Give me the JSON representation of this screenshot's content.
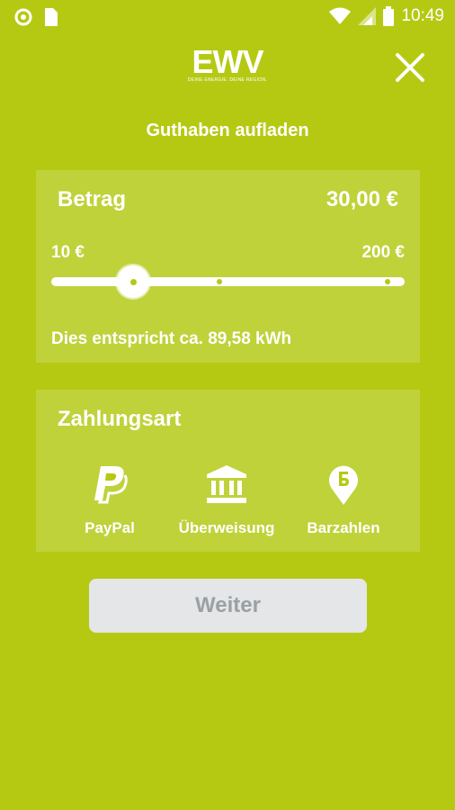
{
  "status_bar": {
    "time": "10:49"
  },
  "header": {
    "logo_text": "EWV",
    "logo_tagline": "DEINE ENERGIE. DEINE REGION.",
    "title": "Guthaben aufladen"
  },
  "amount_card": {
    "label": "Betrag",
    "value": "30,00 €",
    "slider": {
      "min_label": "10 €",
      "max_label": "200 €",
      "min": 10,
      "max": 200,
      "value": 30
    },
    "equivalent": "Dies entspricht ca. 89,58 kWh"
  },
  "payment_card": {
    "title": "Zahlungsart",
    "options": [
      {
        "label": "PayPal",
        "icon": "paypal-icon"
      },
      {
        "label": "Überweisung",
        "icon": "bank-icon"
      },
      {
        "label": "Barzahlen",
        "icon": "barzahlen-pin-icon"
      }
    ]
  },
  "actions": {
    "next_label": "Weiter"
  },
  "colors": {
    "background": "#b5c913",
    "card": "#bfd23a",
    "button_bg": "#e4e6e7",
    "button_text": "#9aa0a4"
  }
}
